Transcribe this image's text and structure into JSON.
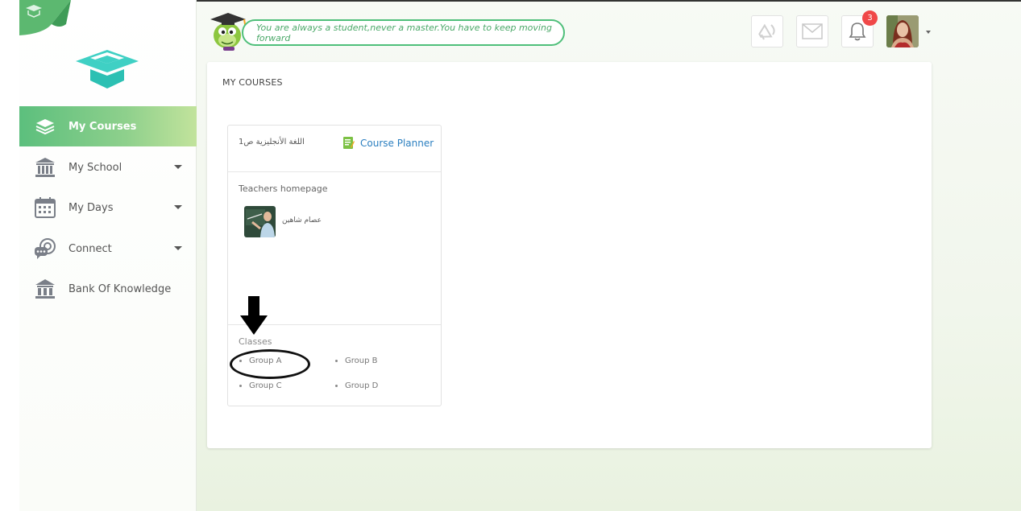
{
  "header": {
    "quote": "You are always a student,never a master.You have to keep moving forward",
    "notification_count": "3"
  },
  "sidebar": {
    "items": [
      {
        "label": "My Courses",
        "icon": "books-icon"
      },
      {
        "label": "My School",
        "icon": "building-icon"
      },
      {
        "label": "My Days",
        "icon": "calendar-icon"
      },
      {
        "label": "Connect",
        "icon": "chat-icon"
      },
      {
        "label": "Bank Of Knowledge",
        "icon": "bank-icon"
      }
    ]
  },
  "main": {
    "title": "MY COURSES",
    "course": {
      "name": "اللغة الأنجليزية ص1",
      "planner_label": "Course Planner",
      "teachers_title": "Teachers homepage",
      "teacher_name": "عصام شاهين",
      "classes_title": "Classes",
      "classes": [
        "Group A",
        "Group B",
        "Group C",
        "Group D"
      ]
    }
  },
  "colors": {
    "accent_green": "#5cbf7d",
    "link_blue": "#2b7fc0",
    "badge_red": "#f04848"
  }
}
